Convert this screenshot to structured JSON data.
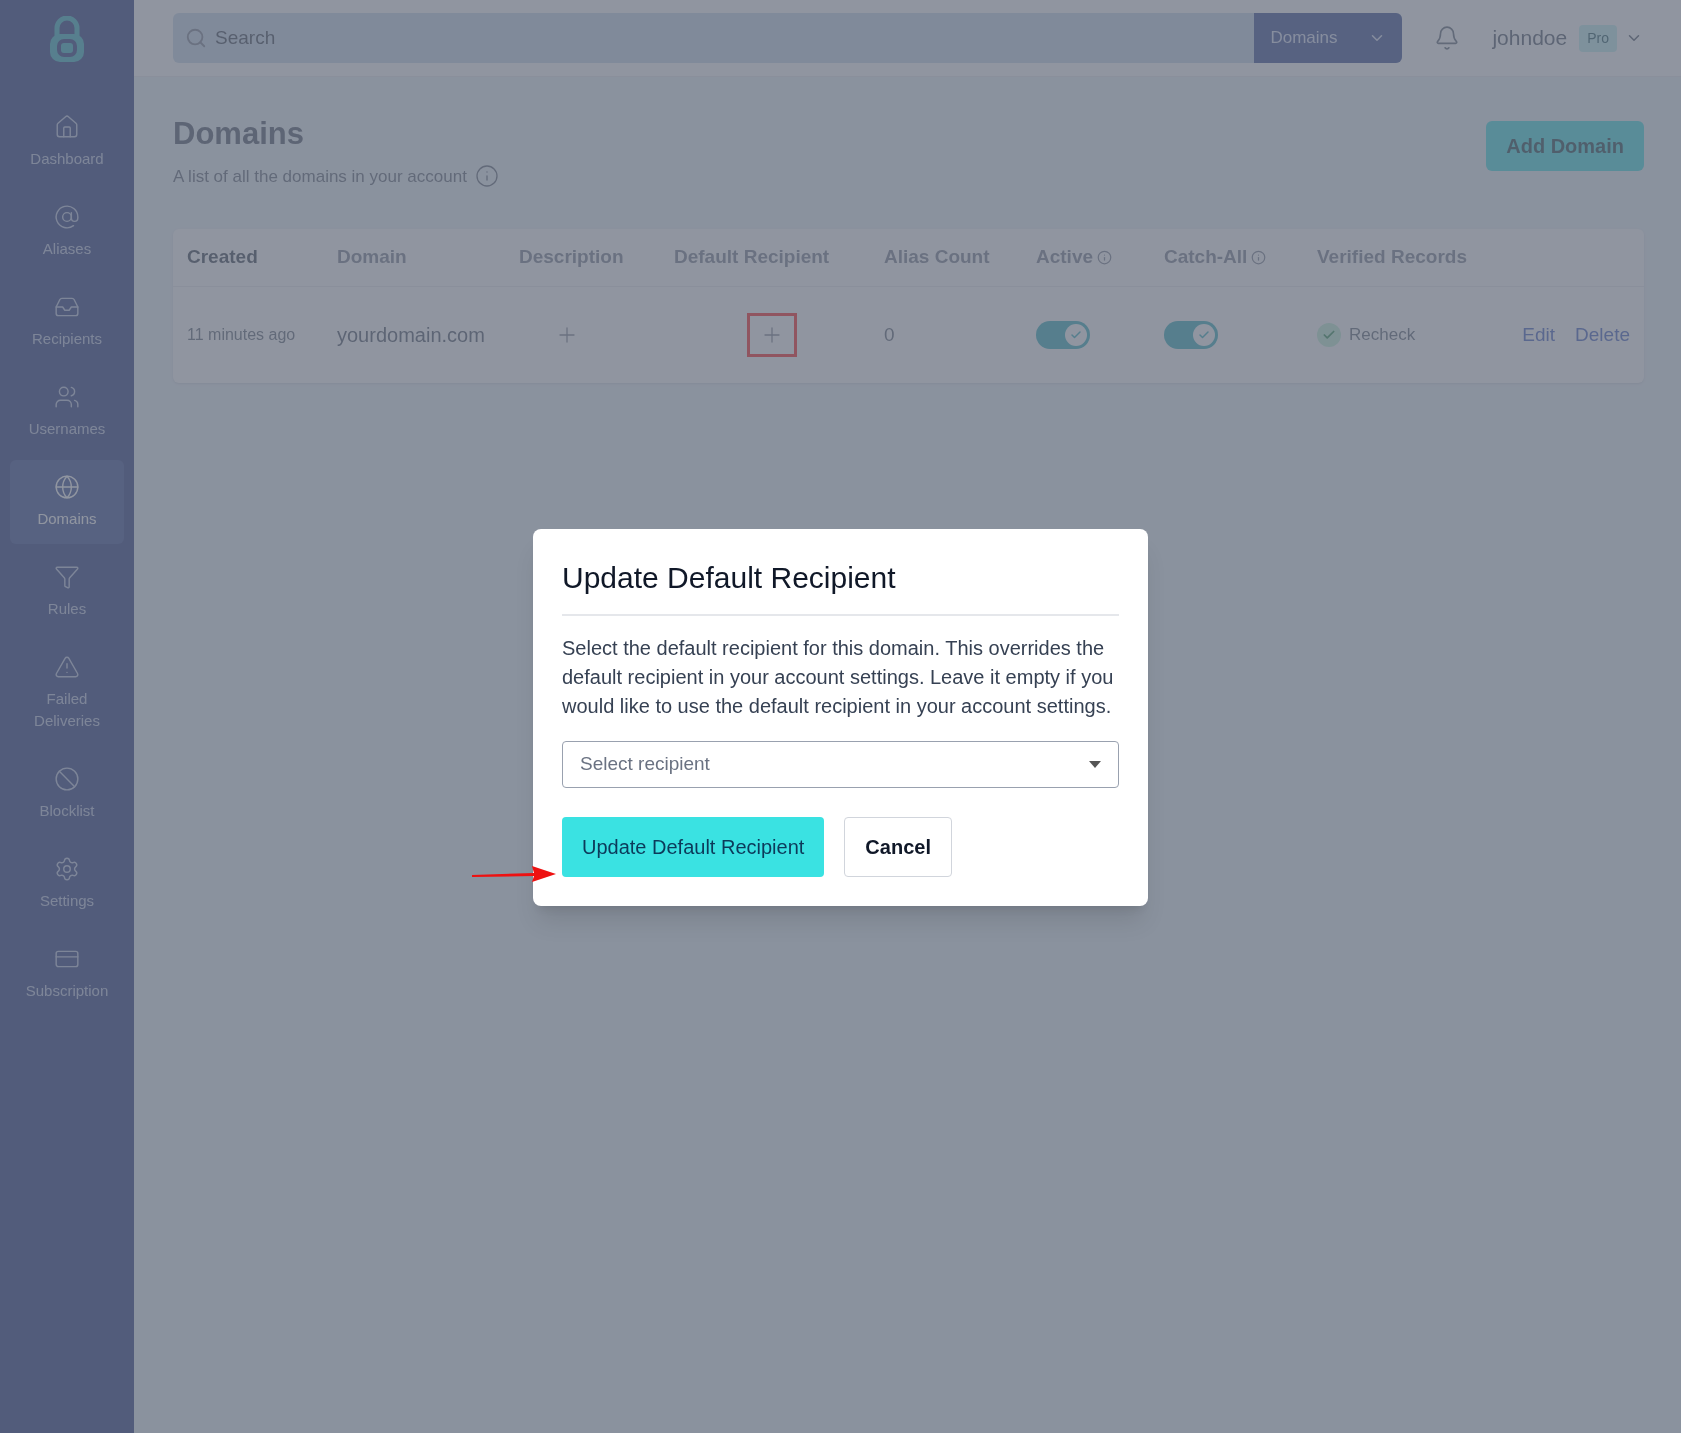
{
  "sidebar": {
    "items": [
      {
        "label": "Dashboard",
        "selected": false
      },
      {
        "label": "Aliases",
        "selected": false
      },
      {
        "label": "Recipients",
        "selected": false
      },
      {
        "label": "Usernames",
        "selected": false
      },
      {
        "label": "Domains",
        "selected": true
      },
      {
        "label": "Rules",
        "selected": false
      },
      {
        "label": "Failed Deliveries",
        "selected": false
      },
      {
        "label": "Blocklist",
        "selected": false
      },
      {
        "label": "Settings",
        "selected": false
      },
      {
        "label": "Subscription",
        "selected": false
      }
    ]
  },
  "header": {
    "search": {
      "placeholder": "Search"
    },
    "scope": "Domains",
    "username": "johndoe",
    "plan_badge": "Pro"
  },
  "page": {
    "title": "Domains",
    "subtitle": "A list of all the domains in your account",
    "add_button": "Add Domain"
  },
  "table": {
    "columns": [
      {
        "label": "Created",
        "info": false
      },
      {
        "label": "Domain",
        "info": false
      },
      {
        "label": "Description",
        "info": false
      },
      {
        "label": "Default Recipient",
        "info": false
      },
      {
        "label": "Alias Count",
        "info": false
      },
      {
        "label": "Active",
        "info": true
      },
      {
        "label": "Catch-All",
        "info": true
      },
      {
        "label": "Verified Records",
        "info": false
      }
    ],
    "rows": [
      {
        "created": "11 minutes ago",
        "domain": "yourdomain.com",
        "alias_count": "0",
        "active": true,
        "catch_all": true,
        "verified": true,
        "recheck": "Recheck",
        "actions": [
          "Edit",
          "Delete"
        ]
      }
    ]
  },
  "modal": {
    "title": "Update Default Recipient",
    "body": "Select the default recipient for this domain. This overrides the default recipient in your account settings. Leave it empty if you would like to use the default recipient in your account settings.",
    "select": {
      "placeholder": "Select recipient"
    },
    "buttons": [
      {
        "label": "Update Default Recipient",
        "kind": "primary"
      },
      {
        "label": "Cancel",
        "kind": "secondary"
      }
    ]
  }
}
